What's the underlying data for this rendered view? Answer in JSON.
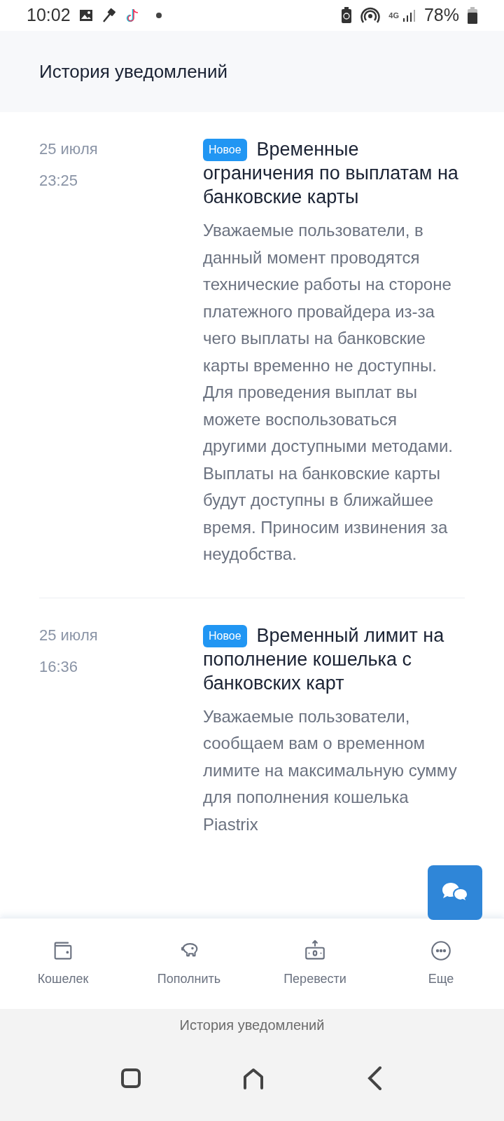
{
  "status_bar": {
    "time": "10:02",
    "network": "4G",
    "battery": "78%"
  },
  "header": {
    "title": "История уведомлений"
  },
  "notifications": [
    {
      "date": "25 июля",
      "time": "23:25",
      "badge": "Новое",
      "is_new": true,
      "title": "Временные ограничения по выплатам на банковские карты",
      "body": "Уважаемые пользователи, в данный момент проводятся технические работы на стороне платежного провайдера из-за чего выплаты на банковские карты временно не доступны. Для проведения выплат вы можете воспользоваться другими доступными методами. Выплаты на банковские карты будут доступны в ближайшее время. Приносим извинения за неудобства."
    },
    {
      "date": "25 июля",
      "time": "16:36",
      "badge": "Новое",
      "is_new": true,
      "title": "Временный лимит на пополнение кошелька с банковских карт",
      "body": "Уважаемые пользователи, сообщаем вам о временном лимите на максимальную сумму для пополнения кошелька Piastrix"
    }
  ],
  "bottom_nav": [
    {
      "kind": "wallet",
      "label": "Кошелек"
    },
    {
      "kind": "piggy",
      "label": "Пополнить"
    },
    {
      "kind": "transfer",
      "label": "Перевести"
    },
    {
      "kind": "more",
      "label": "Еще"
    }
  ],
  "system_bar": {
    "label": "История уведомлений"
  }
}
